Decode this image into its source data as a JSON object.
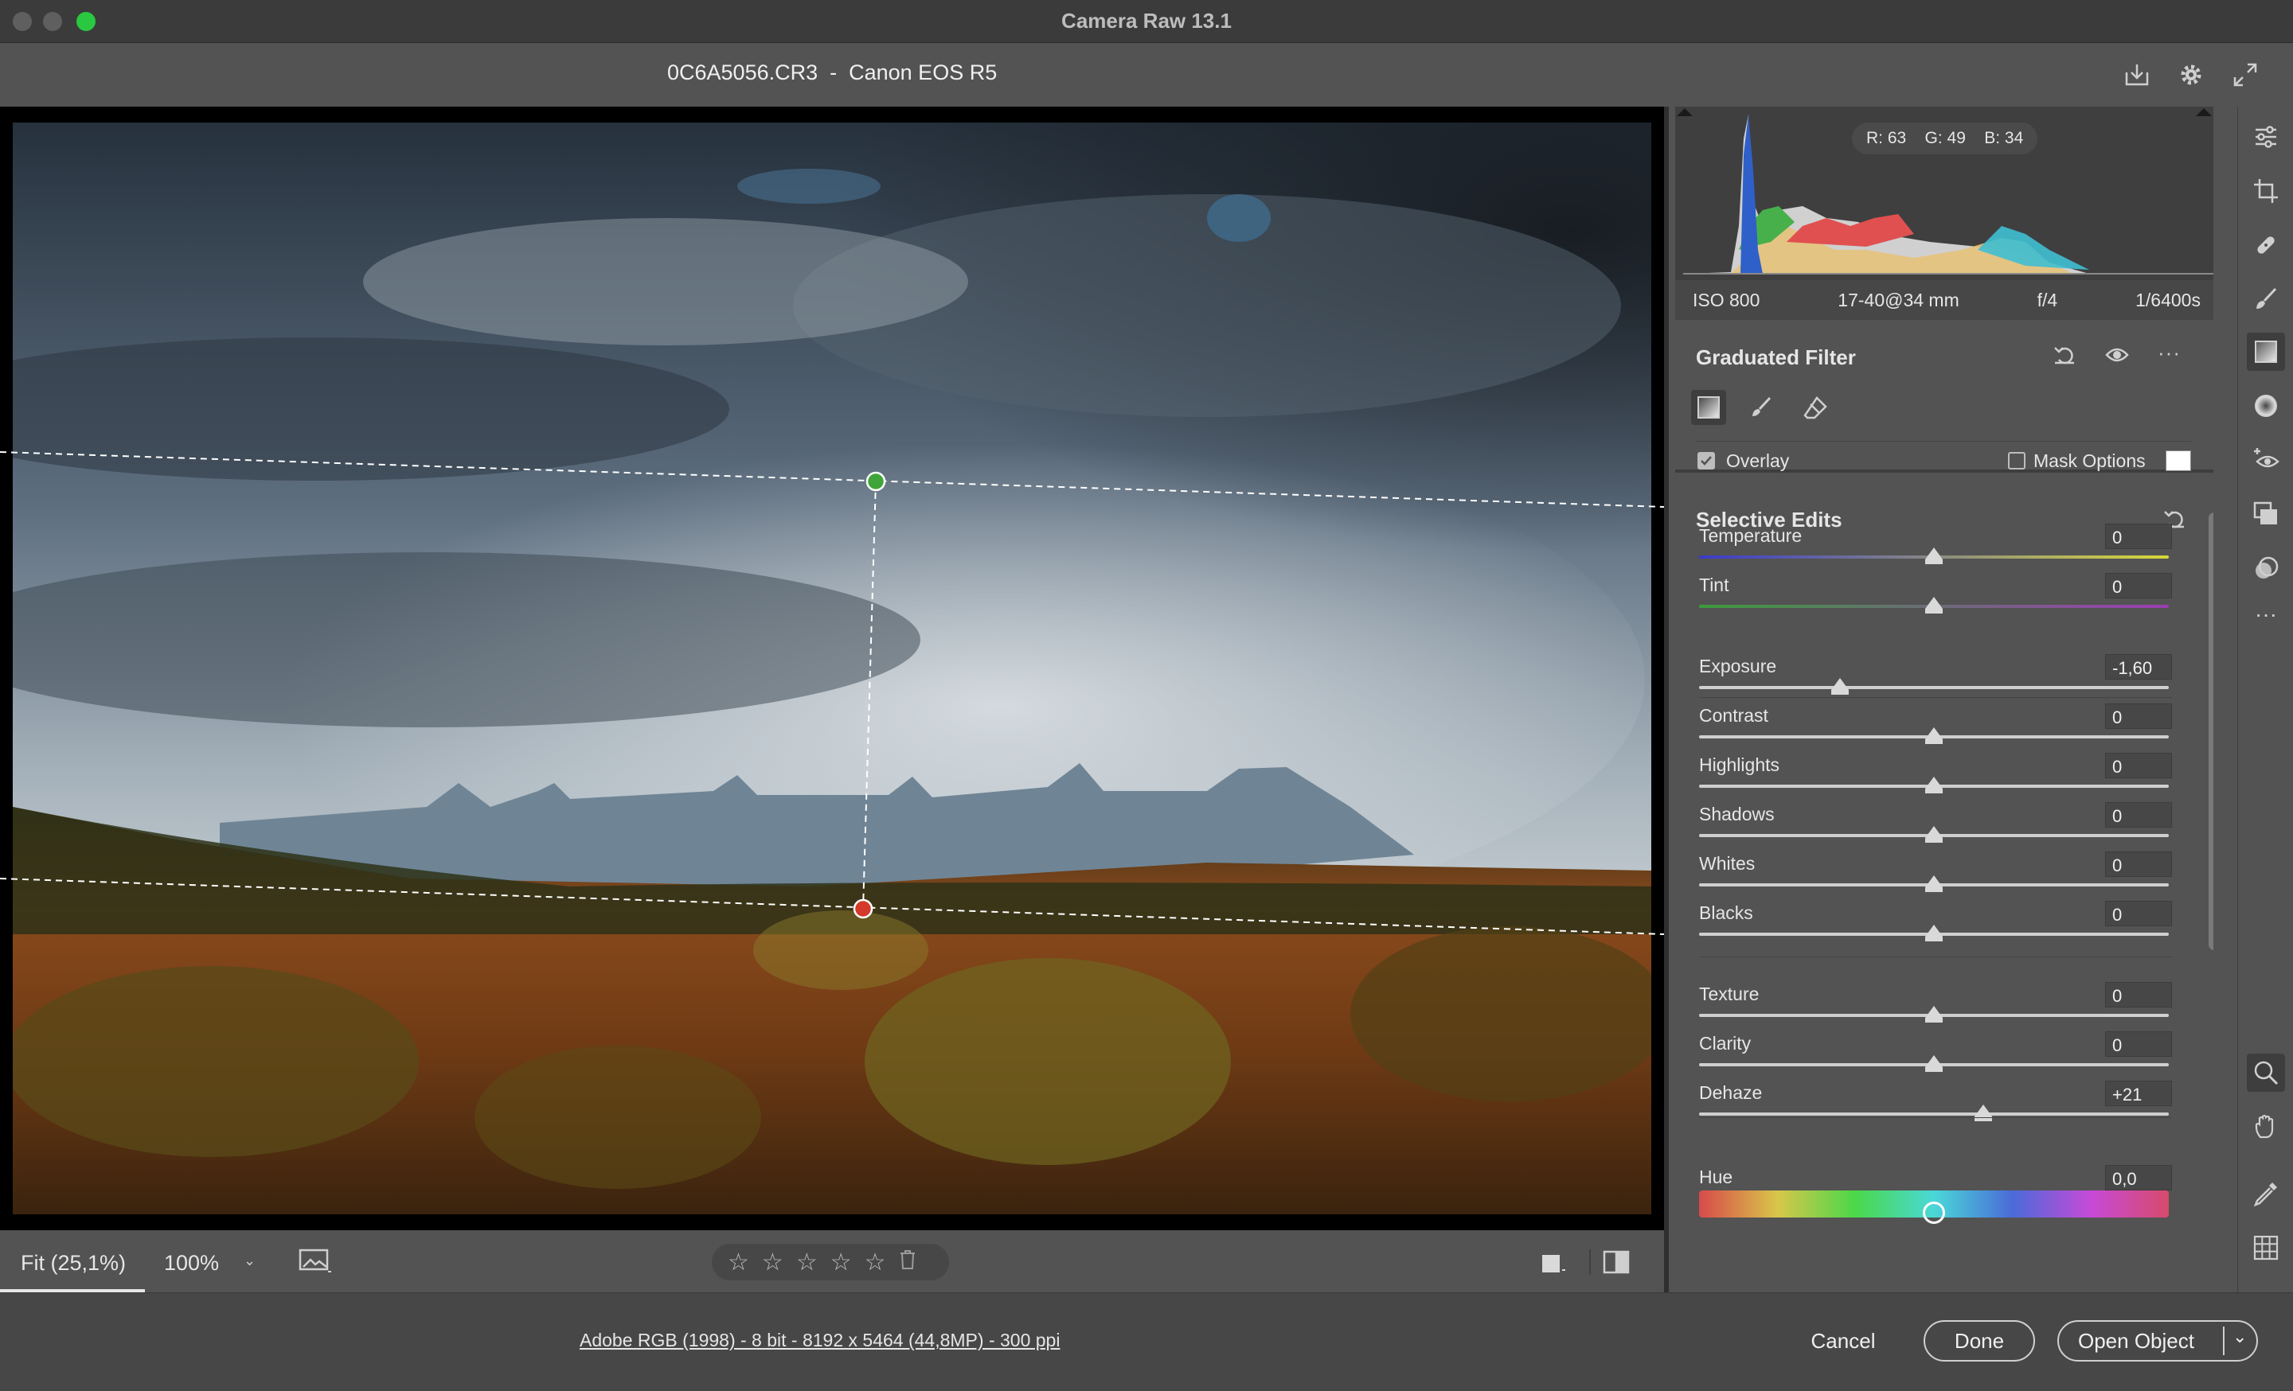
{
  "window": {
    "title": "Camera Raw 13.1"
  },
  "header": {
    "file_title": "0C6A5056.CR3  -  Canon EOS R5"
  },
  "histogram": {
    "readout": "R: 63    G: 49    B: 34"
  },
  "exif": {
    "iso": "ISO 800",
    "lens": "17-40@34 mm",
    "aperture": "f/4",
    "shutter": "1/6400s"
  },
  "graduated_filter": {
    "title": "Graduated Filter",
    "overlay_label": "Overlay",
    "overlay_checked": true,
    "mask_options_label": "Mask Options",
    "mask_options_checked": false
  },
  "selective_edits": {
    "title": "Selective Edits",
    "sliders": [
      {
        "label": "Temperature",
        "value": "0",
        "position": 0.5
      },
      {
        "label": "Tint",
        "value": "0",
        "position": 0.5
      },
      {
        "label": "Exposure",
        "value": "-1,60",
        "position": 0.3
      },
      {
        "label": "Contrast",
        "value": "0",
        "position": 0.5
      },
      {
        "label": "Highlights",
        "value": "0",
        "position": 0.5
      },
      {
        "label": "Shadows",
        "value": "0",
        "position": 0.5
      },
      {
        "label": "Whites",
        "value": "0",
        "position": 0.5
      },
      {
        "label": "Blacks",
        "value": "0",
        "position": 0.5
      },
      {
        "label": "Texture",
        "value": "0",
        "position": 0.5
      },
      {
        "label": "Clarity",
        "value": "0",
        "position": 0.5
      },
      {
        "label": "Dehaze",
        "value": "+21",
        "position": 0.605
      },
      {
        "label": "Hue",
        "value": "0,0",
        "position": 0.5
      }
    ]
  },
  "canvas_toolbar": {
    "zoom_fit": "Fit (25,1%)",
    "zoom_level": "100%",
    "rating": 0
  },
  "footer": {
    "workflow_options": "Adobe RGB (1998) - 8 bit - 8192 x 5464 (44,8MP) - 300 ppi",
    "cancel": "Cancel",
    "done": "Done",
    "open": "Open Object"
  },
  "colors": {
    "accent_green_pin": "#3fa53a",
    "accent_red_pin": "#d33a2c",
    "panel_bg": "#535353",
    "title_bar": "#3b3b3b"
  }
}
